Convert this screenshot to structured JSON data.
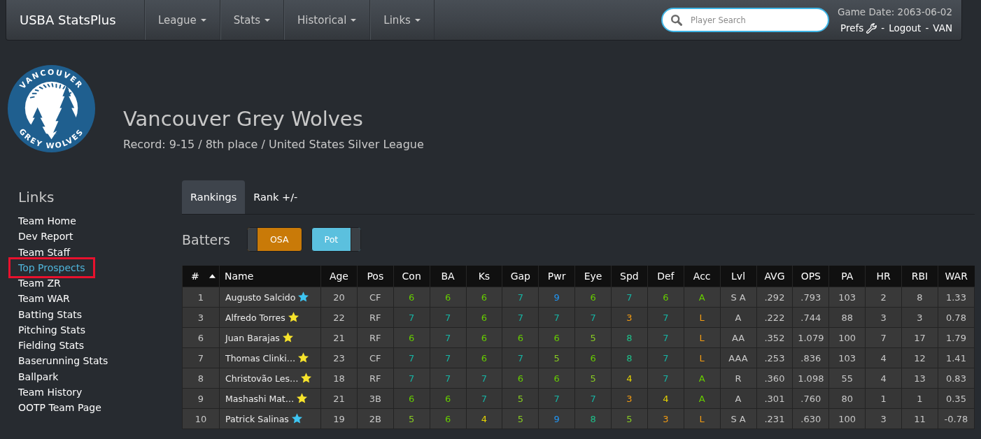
{
  "navbar": {
    "brand": "USBA StatsPlus",
    "menu": [
      {
        "label": "League",
        "dropdown": true
      },
      {
        "label": "Stats",
        "dropdown": true
      },
      {
        "label": "Historical",
        "dropdown": true
      },
      {
        "label": "Links",
        "dropdown": true
      }
    ],
    "search": {
      "placeholder": "Player Search"
    },
    "game_date": "Game Date: 2063-06-02",
    "user_links": [
      {
        "label": "Prefs",
        "kind": "settings"
      },
      {
        "label": "-",
        "kind": "separator"
      },
      {
        "label": "Logout",
        "kind": "link"
      },
      {
        "label": "-",
        "kind": "separator"
      },
      {
        "label": "VAN",
        "kind": "link"
      }
    ]
  },
  "team": {
    "logo": {
      "top_text": "VANCOUVER",
      "bottom_text": "GREY WOLVES"
    },
    "name": "Vancouver Grey Wolves",
    "record": "Record: 9-15 / 8th place / United States Silver League"
  },
  "sidebar": {
    "title": "Links",
    "items": [
      {
        "label": "Team Home",
        "selected": false
      },
      {
        "label": "Dev Report",
        "selected": false
      },
      {
        "label": "Team Staff",
        "selected": false
      },
      {
        "label": "Top Prospects",
        "selected": true
      },
      {
        "label": "Team ZR",
        "selected": false
      },
      {
        "label": "Team WAR",
        "selected": false
      },
      {
        "label": "Batting Stats",
        "selected": false
      },
      {
        "label": "Pitching Stats",
        "selected": false
      },
      {
        "label": "Fielding Stats",
        "selected": false
      },
      {
        "label": "Baserunning Stats",
        "selected": false
      },
      {
        "label": "Ballpark",
        "selected": false
      },
      {
        "label": "Team History",
        "selected": false
      },
      {
        "label": "OOTP Team Page",
        "selected": false
      }
    ]
  },
  "tabs": [
    {
      "label": "Rankings",
      "selected": true
    },
    {
      "label": "Rank +/-",
      "selected": false
    }
  ],
  "section": {
    "title": "Batters",
    "toggles": [
      {
        "label": "OSA",
        "on": false
      },
      {
        "label": "Pot",
        "on": true
      }
    ]
  },
  "table": {
    "columns": [
      {
        "label": "#",
        "sorted": true
      },
      {
        "label": "Name",
        "sorted": false
      },
      {
        "label": "Age",
        "sorted": false
      },
      {
        "label": "Pos",
        "sorted": false
      },
      {
        "label": "Con",
        "sorted": false
      },
      {
        "label": "BA",
        "sorted": false
      },
      {
        "label": "Ks",
        "sorted": false
      },
      {
        "label": "Gap",
        "sorted": false
      },
      {
        "label": "Pwr",
        "sorted": false
      },
      {
        "label": "Eye",
        "sorted": false
      },
      {
        "label": "Spd",
        "sorted": false
      },
      {
        "label": "Def",
        "sorted": false
      },
      {
        "label": "Acc",
        "sorted": false
      },
      {
        "label": "Lvl",
        "sorted": false
      },
      {
        "label": "AVG",
        "sorted": false
      },
      {
        "label": "OPS",
        "sorted": false
      },
      {
        "label": "PA",
        "sorted": false
      },
      {
        "label": "HR",
        "sorted": false
      },
      {
        "label": "RBI",
        "sorted": false
      },
      {
        "label": "WAR",
        "sorted": false
      }
    ],
    "rows": [
      {
        "rank": "1",
        "name": "Augusto Salcido",
        "star": {
          "color": "#3ec5f2"
        },
        "age": "20",
        "pos": "CF",
        "ratings": [
          {
            "value": "6",
            "color": "#66cc00"
          },
          {
            "value": "6",
            "color": "#66cc00"
          },
          {
            "value": "6",
            "color": "#66cc00"
          },
          {
            "value": "7",
            "color": "#17b3a3"
          },
          {
            "value": "9",
            "color": "#2196f3"
          },
          {
            "value": "6",
            "color": "#66cc00"
          },
          {
            "value": "7",
            "color": "#17b3a3"
          },
          {
            "value": "6",
            "color": "#66cc00"
          },
          {
            "value": "A",
            "color": "#66cc00"
          }
        ],
        "level": "S A",
        "stats": [
          ".292",
          ".793",
          "103",
          "2",
          "8",
          "1.33"
        ]
      },
      {
        "rank": "3",
        "name": "Alfredo Torres",
        "star": {
          "color": "#f7e32b"
        },
        "age": "22",
        "pos": "RF",
        "ratings": [
          {
            "value": "7",
            "color": "#17b3a3"
          },
          {
            "value": "7",
            "color": "#17b3a3"
          },
          {
            "value": "6",
            "color": "#66cc00"
          },
          {
            "value": "7",
            "color": "#17b3a3"
          },
          {
            "value": "7",
            "color": "#17b3a3"
          },
          {
            "value": "7",
            "color": "#17b3a3"
          },
          {
            "value": "3",
            "color": "#f39c12"
          },
          {
            "value": "7",
            "color": "#17b3a3"
          },
          {
            "value": "L",
            "color": "#f39c12"
          }
        ],
        "level": "A",
        "stats": [
          ".222",
          ".744",
          "88",
          "3",
          "3",
          "0.78"
        ]
      },
      {
        "rank": "6",
        "name": "Juan Barajas",
        "star": {
          "color": "#f7e32b"
        },
        "age": "21",
        "pos": "RF",
        "ratings": [
          {
            "value": "6",
            "color": "#66cc00"
          },
          {
            "value": "7",
            "color": "#17b3a3"
          },
          {
            "value": "6",
            "color": "#66cc00"
          },
          {
            "value": "6",
            "color": "#66cc00"
          },
          {
            "value": "6",
            "color": "#66cc00"
          },
          {
            "value": "5",
            "color": "#88cc22"
          },
          {
            "value": "8",
            "color": "#1ec28b"
          },
          {
            "value": "7",
            "color": "#17b3a3"
          },
          {
            "value": "L",
            "color": "#f39c12"
          }
        ],
        "level": "AA",
        "stats": [
          ".352",
          "1.079",
          "100",
          "7",
          "17",
          "1.79"
        ]
      },
      {
        "rank": "7",
        "name": "Thomas Clinki…",
        "star": {
          "color": "#f7e32b"
        },
        "age": "23",
        "pos": "CF",
        "ratings": [
          {
            "value": "7",
            "color": "#17b3a3"
          },
          {
            "value": "7",
            "color": "#17b3a3"
          },
          {
            "value": "6",
            "color": "#66cc00"
          },
          {
            "value": "7",
            "color": "#17b3a3"
          },
          {
            "value": "5",
            "color": "#88cc22"
          },
          {
            "value": "6",
            "color": "#66cc00"
          },
          {
            "value": "8",
            "color": "#1ec28b"
          },
          {
            "value": "7",
            "color": "#17b3a3"
          },
          {
            "value": "L",
            "color": "#f39c12"
          }
        ],
        "level": "AAA",
        "stats": [
          ".253",
          ".836",
          "103",
          "4",
          "12",
          "1.41"
        ]
      },
      {
        "rank": "8",
        "name": "Christovão Les…",
        "star": {
          "color": "#f7e32b"
        },
        "age": "18",
        "pos": "RF",
        "ratings": [
          {
            "value": "7",
            "color": "#17b3a3"
          },
          {
            "value": "7",
            "color": "#17b3a3"
          },
          {
            "value": "7",
            "color": "#17b3a3"
          },
          {
            "value": "6",
            "color": "#66cc00"
          },
          {
            "value": "6",
            "color": "#66cc00"
          },
          {
            "value": "5",
            "color": "#88cc22"
          },
          {
            "value": "4",
            "color": "#e8d500"
          },
          {
            "value": "7",
            "color": "#17b3a3"
          },
          {
            "value": "A",
            "color": "#66cc00"
          }
        ],
        "level": "R",
        "stats": [
          ".360",
          "1.098",
          "55",
          "4",
          "13",
          "0.83"
        ]
      },
      {
        "rank": "9",
        "name": "Mashashi Mat…",
        "star": {
          "color": "#f7e32b"
        },
        "age": "21",
        "pos": "3B",
        "ratings": [
          {
            "value": "6",
            "color": "#66cc00"
          },
          {
            "value": "6",
            "color": "#66cc00"
          },
          {
            "value": "7",
            "color": "#17b3a3"
          },
          {
            "value": "5",
            "color": "#88cc22"
          },
          {
            "value": "7",
            "color": "#17b3a3"
          },
          {
            "value": "7",
            "color": "#17b3a3"
          },
          {
            "value": "3",
            "color": "#f39c12"
          },
          {
            "value": "4",
            "color": "#e8d500"
          },
          {
            "value": "A",
            "color": "#66cc00"
          }
        ],
        "level": "A",
        "stats": [
          ".301",
          ".760",
          "80",
          "1",
          "1",
          "0.35"
        ]
      },
      {
        "rank": "10",
        "name": "Patrick Salinas",
        "star": {
          "color": "#3ec5f2"
        },
        "age": "19",
        "pos": "2B",
        "ratings": [
          {
            "value": "5",
            "color": "#88cc22"
          },
          {
            "value": "6",
            "color": "#66cc00"
          },
          {
            "value": "4",
            "color": "#e8d500"
          },
          {
            "value": "5",
            "color": "#88cc22"
          },
          {
            "value": "9",
            "color": "#2196f3"
          },
          {
            "value": "8",
            "color": "#1ec28b"
          },
          {
            "value": "5",
            "color": "#88cc22"
          },
          {
            "value": "3",
            "color": "#f39c12"
          },
          {
            "value": "L",
            "color": "#f39c12"
          }
        ],
        "level": "S A",
        "stats": [
          ".231",
          ".630",
          "100",
          "3",
          "11",
          "-0.78"
        ]
      }
    ]
  }
}
